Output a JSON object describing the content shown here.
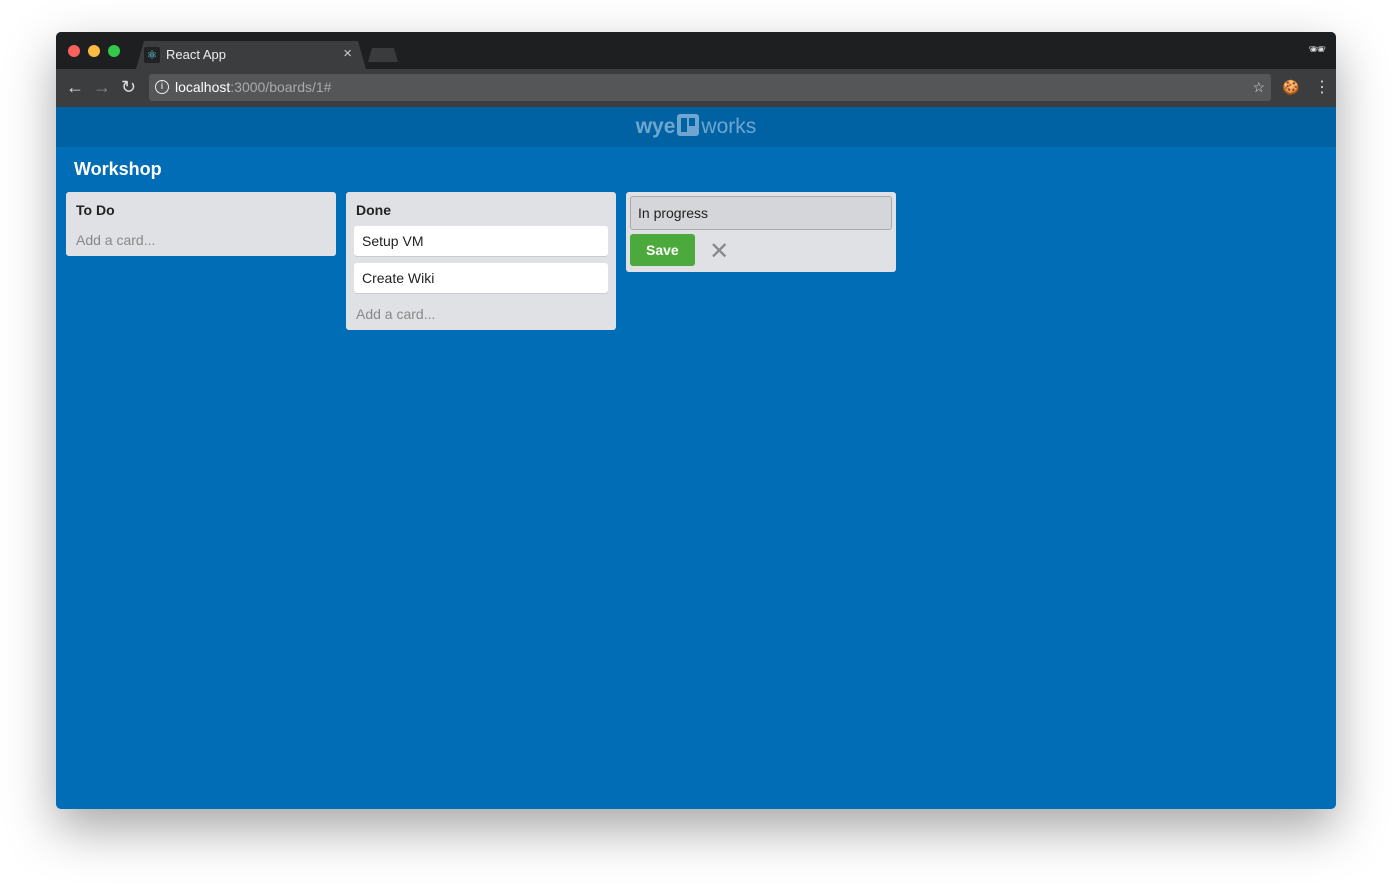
{
  "browser": {
    "tab_title": "React App",
    "url_host": "localhost",
    "url_rest": ":3000/boards/1#"
  },
  "app": {
    "logo_left": "wye",
    "logo_right": "works"
  },
  "board": {
    "title": "Workshop",
    "lists": [
      {
        "title": "To Do",
        "cards": [],
        "add_label": "Add a card..."
      },
      {
        "title": "Done",
        "cards": [
          "Setup VM",
          "Create Wiki"
        ],
        "add_label": "Add a card..."
      }
    ],
    "new_list": {
      "value": "In progress",
      "save_label": "Save"
    }
  }
}
